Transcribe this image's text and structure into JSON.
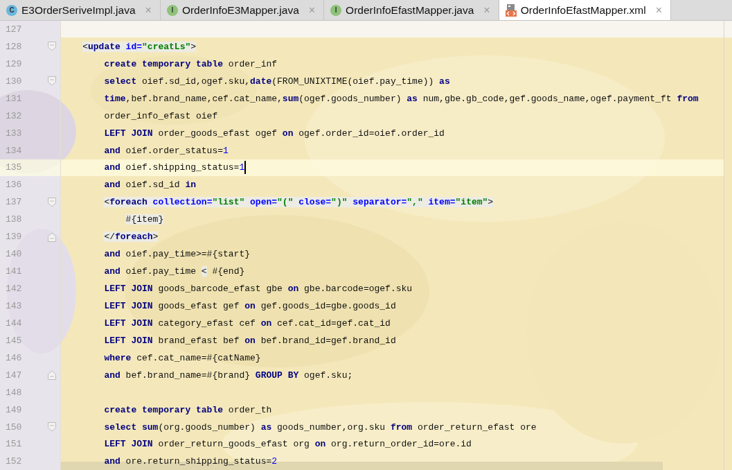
{
  "tabs": [
    {
      "label": "E3OrderSeriveImpl.java",
      "selected": false,
      "kind": "class",
      "icon_letter": "C",
      "close": "×"
    },
    {
      "label": "OrderInfoE3Mapper.java",
      "selected": false,
      "kind": "interface",
      "icon_letter": "I",
      "close": "×"
    },
    {
      "label": "OrderInfoEfastMapper.java",
      "selected": false,
      "kind": "interface",
      "icon_letter": "I",
      "close": "×"
    },
    {
      "label": "OrderInfoEfastMapper.xml",
      "selected": true,
      "kind": "xml",
      "close": "×"
    }
  ],
  "editor": {
    "lines": [
      {
        "number": "127"
      },
      {
        "number": "128",
        "fold_start": true,
        "tokens": [
          {
            "kind": "tagp",
            "text": "<"
          },
          {
            "kind": "tag",
            "text": "update"
          },
          {
            "kind": "attr",
            "text": " id="
          },
          {
            "kind": "str",
            "text": "\"creatLs\""
          },
          {
            "kind": "tagp",
            "text": ">"
          }
        ],
        "children": [
          {
            "number": "129",
            "tokens": [
              {
                "kind": "kw",
                "text": "create temporary table"
              },
              {
                "kind": "text",
                "text": " order_inf"
              }
            ]
          },
          {
            "number": "130",
            "fold_start": true,
            "tokens": [
              {
                "kind": "kw",
                "text": "select"
              },
              {
                "kind": "text",
                "text": " oief.sd_id,ogef.sku,"
              },
              {
                "kind": "kw",
                "text": "date"
              },
              {
                "kind": "text",
                "text": "(FROM_UNIXTIME(oief.pay_time)) "
              },
              {
                "kind": "kw",
                "text": "as"
              }
            ]
          },
          {
            "number": "131",
            "tokens": [
              {
                "kind": "kw",
                "text": "time"
              },
              {
                "kind": "text",
                "text": ",bef.brand_name,cef.cat_name,"
              },
              {
                "kind": "kw",
                "text": "sum"
              },
              {
                "kind": "text",
                "text": "(ogef.goods_number) "
              },
              {
                "kind": "kw",
                "text": "as"
              },
              {
                "kind": "text",
                "text": " num,gbe.gb_code,gef.goods_name,ogef.payment_ft "
              },
              {
                "kind": "kw",
                "text": "from"
              }
            ]
          },
          {
            "number": "132",
            "tokens": [
              {
                "kind": "text",
                "text": "order_info_efast oief"
              }
            ]
          },
          {
            "number": "133",
            "tokens": [
              {
                "kind": "kw",
                "text": "LEFT JOIN"
              },
              {
                "kind": "text",
                "text": " order_goods_efast ogef "
              },
              {
                "kind": "kw",
                "text": "on"
              },
              {
                "kind": "text",
                "text": " ogef.order_id=oief.order_id"
              }
            ]
          },
          {
            "number": "134",
            "tokens": [
              {
                "kind": "kw",
                "text": "and"
              },
              {
                "kind": "text",
                "text": " oief.order_status="
              },
              {
                "kind": "num",
                "text": "1"
              }
            ]
          },
          {
            "number": "135",
            "current": true,
            "caret": true,
            "tokens": [
              {
                "kind": "kw",
                "text": "and"
              },
              {
                "kind": "text",
                "text": " oief.shipping_status="
              },
              {
                "kind": "num",
                "text": "1"
              }
            ]
          },
          {
            "number": "136",
            "tokens": [
              {
                "kind": "kw",
                "text": "and"
              },
              {
                "kind": "text",
                "text": " oief.sd_id "
              },
              {
                "kind": "kw",
                "text": "in"
              }
            ]
          },
          {
            "number": "137",
            "fold_start": true,
            "tokens": [
              {
                "kind": "tagp",
                "text": "<"
              },
              {
                "kind": "tag",
                "text": "foreach"
              },
              {
                "kind": "attr",
                "text": " collection="
              },
              {
                "kind": "str",
                "text": "\"list\""
              },
              {
                "kind": "attr",
                "text": " open="
              },
              {
                "kind": "str",
                "text": "\"(\""
              },
              {
                "kind": "attr",
                "text": " close="
              },
              {
                "kind": "str",
                "text": "\")\""
              },
              {
                "kind": "attr",
                "text": " separator="
              },
              {
                "kind": "str",
                "text": "\",\""
              },
              {
                "kind": "attr",
                "text": " item="
              },
              {
                "kind": "str",
                "text": "\"item\""
              },
              {
                "kind": "tagp",
                "text": ">"
              }
            ],
            "children": [
              {
                "number": "138",
                "tokens": [
                  {
                    "kind": "tagtext",
                    "text": "#{item}"
                  }
                ]
              }
            ]
          },
          {
            "number": "139",
            "fold_end": true,
            "tokens": [
              {
                "kind": "tagp",
                "text": "</"
              },
              {
                "kind": "tag",
                "text": "foreach"
              },
              {
                "kind": "tagp",
                "text": ">"
              }
            ]
          },
          {
            "number": "140",
            "tokens": [
              {
                "kind": "kw",
                "text": "and"
              },
              {
                "kind": "text",
                "text": " oief.pay_time>=#{start}"
              }
            ]
          },
          {
            "number": "141",
            "tokens": [
              {
                "kind": "kw",
                "text": "and"
              },
              {
                "kind": "text",
                "text": " oief.pay_time "
              },
              {
                "kind": "tagtext",
                "text": "<"
              },
              {
                "kind": "text",
                "text": " #{end}"
              }
            ]
          },
          {
            "number": "142",
            "tokens": [
              {
                "kind": "kw",
                "text": "LEFT JOIN"
              },
              {
                "kind": "text",
                "text": " goods_barcode_efast gbe "
              },
              {
                "kind": "kw",
                "text": "on"
              },
              {
                "kind": "text",
                "text": " gbe.barcode=ogef.sku"
              }
            ]
          },
          {
            "number": "143",
            "tokens": [
              {
                "kind": "kw",
                "text": "LEFT JOIN"
              },
              {
                "kind": "text",
                "text": " goods_efast gef "
              },
              {
                "kind": "kw",
                "text": "on"
              },
              {
                "kind": "text",
                "text": " gef.goods_id=gbe.goods_id"
              }
            ]
          },
          {
            "number": "144",
            "tokens": [
              {
                "kind": "kw",
                "text": "LEFT JOIN"
              },
              {
                "kind": "text",
                "text": " category_efast cef "
              },
              {
                "kind": "kw",
                "text": "on"
              },
              {
                "kind": "text",
                "text": " cef.cat_id=gef.cat_id"
              }
            ]
          },
          {
            "number": "145",
            "tokens": [
              {
                "kind": "kw",
                "text": "LEFT JOIN"
              },
              {
                "kind": "text",
                "text": " brand_efast bef "
              },
              {
                "kind": "kw",
                "text": "on"
              },
              {
                "kind": "text",
                "text": " bef.brand_id=gef.brand_id"
              }
            ]
          },
          {
            "number": "146",
            "tokens": [
              {
                "kind": "kw",
                "text": "where"
              },
              {
                "kind": "text",
                "text": " cef.cat_name=#{catName}"
              }
            ]
          },
          {
            "number": "147",
            "fold_end": true,
            "tokens": [
              {
                "kind": "kw",
                "text": "and"
              },
              {
                "kind": "text",
                "text": " bef.brand_name=#{brand} "
              },
              {
                "kind": "kw",
                "text": "GROUP BY"
              },
              {
                "kind": "text",
                "text": " ogef.sku;"
              }
            ]
          },
          {
            "number": "148"
          },
          {
            "number": "149",
            "tokens": [
              {
                "kind": "kw",
                "text": "create temporary table"
              },
              {
                "kind": "text",
                "text": " order_th"
              }
            ]
          },
          {
            "number": "150",
            "fold_start": true,
            "tokens": [
              {
                "kind": "kw",
                "text": "select sum"
              },
              {
                "kind": "text",
                "text": "(org.goods_number) "
              },
              {
                "kind": "kw",
                "text": "as"
              },
              {
                "kind": "text",
                "text": " goods_number,org.sku "
              },
              {
                "kind": "kw",
                "text": "from"
              },
              {
                "kind": "text",
                "text": " order_return_efast ore"
              }
            ]
          },
          {
            "number": "151",
            "tokens": [
              {
                "kind": "kw",
                "text": "LEFT JOIN"
              },
              {
                "kind": "text",
                "text": " order_return_goods_efast org "
              },
              {
                "kind": "kw",
                "text": "on"
              },
              {
                "kind": "text",
                "text": " org.return_order_id=ore.id"
              }
            ]
          },
          {
            "number": "152",
            "tokens": [
              {
                "kind": "kw",
                "text": "and"
              },
              {
                "kind": "text",
                "text": " ore.return_shipping_status="
              },
              {
                "kind": "num",
                "text": "2"
              }
            ]
          }
        ]
      }
    ]
  }
}
